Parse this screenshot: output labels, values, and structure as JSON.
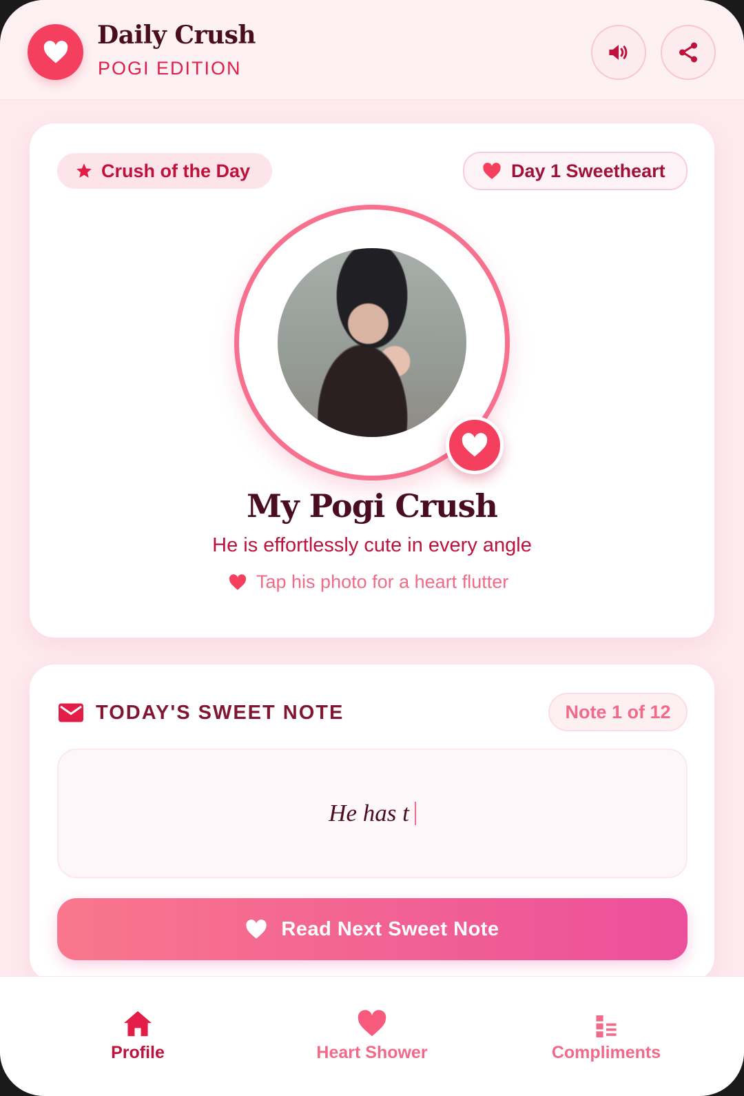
{
  "header": {
    "title": "Daily Crush",
    "subtitle": "POGI EDITION",
    "icons": [
      "heart-icon",
      "speaker-icon",
      "share-icon"
    ]
  },
  "profile": {
    "badge_left": "Crush of the Day",
    "badge_right": "Day 1 Sweetheart",
    "name": "My Pogi Crush",
    "description": "He is effortlessly cute in every angle",
    "hint": "Tap his photo for a heart flutter"
  },
  "note": {
    "heading": "TODAY'S SWEET NOTE",
    "counter": "Note 1 of 12",
    "text": "He has t",
    "next_button": "Read Next Sweet Note"
  },
  "nav": {
    "items": [
      {
        "label": "Profile",
        "icon": "home-icon",
        "active": true
      },
      {
        "label": "Heart Shower",
        "icon": "heart-icon",
        "active": false
      },
      {
        "label": "Compliments",
        "icon": "list-icon",
        "active": false
      }
    ]
  },
  "colors": {
    "accent": "#f43f5e",
    "deep": "#4a0d1f",
    "rose": "#be123c",
    "soft_pink": "#fde9ee",
    "gradient_start": "#f9778c",
    "gradient_end": "#ec4f9b"
  }
}
